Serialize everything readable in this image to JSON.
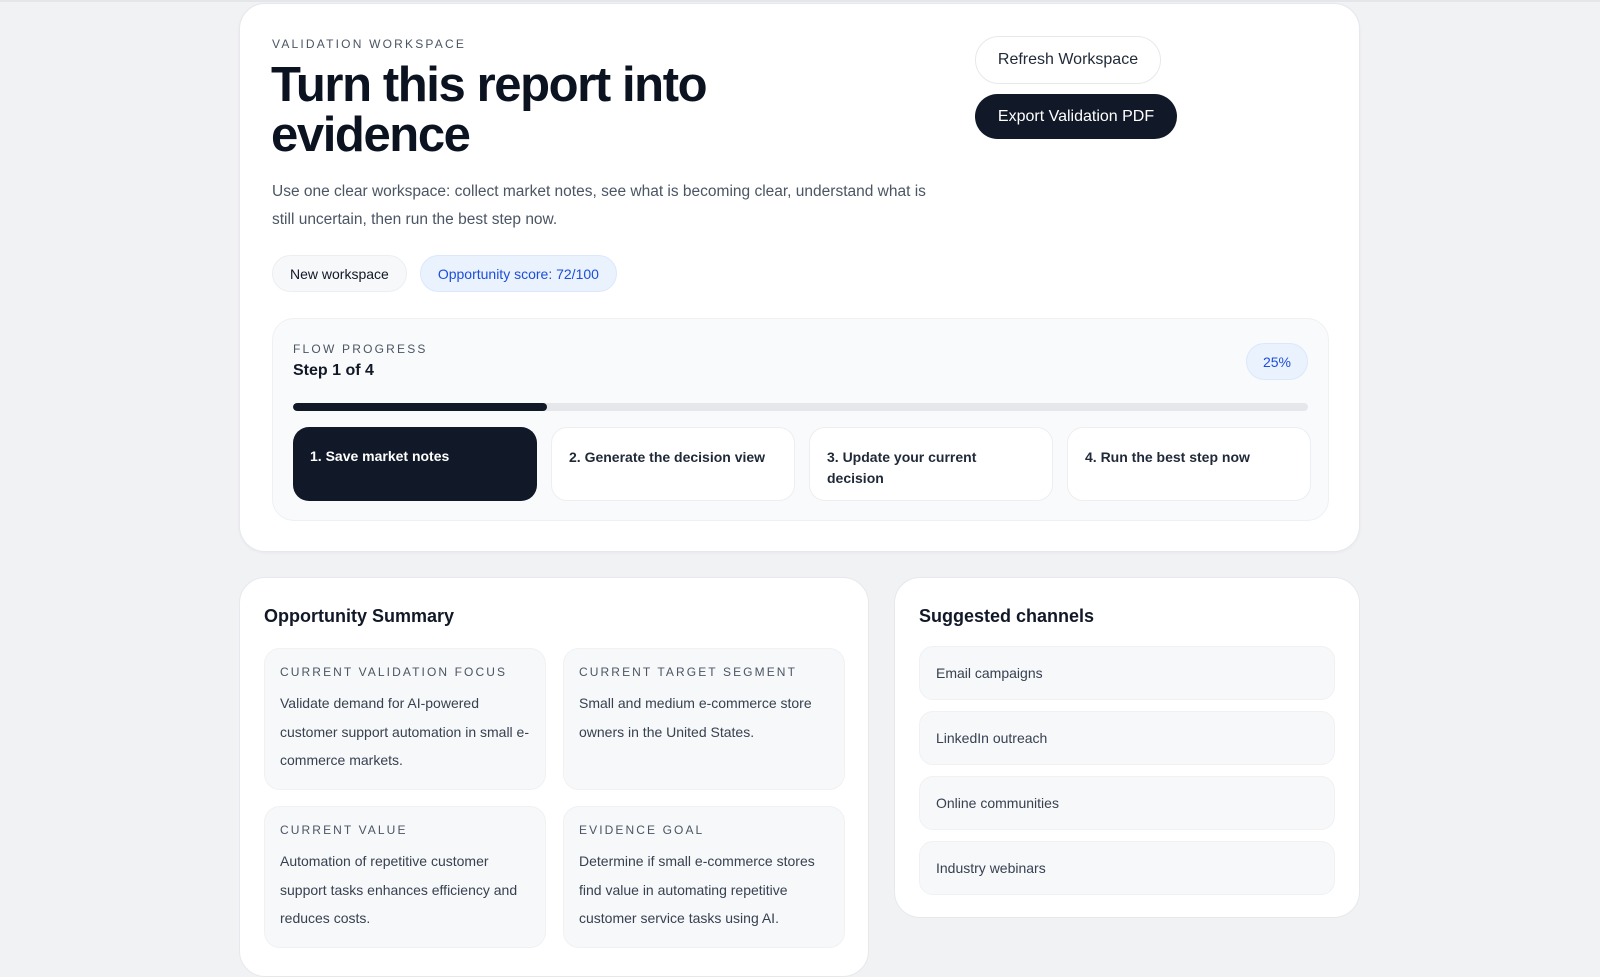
{
  "header": {
    "eyebrow": "VALIDATION WORKSPACE",
    "title": "Turn this report into evidence",
    "description": "Use one clear workspace: collect market notes, see what is becoming clear, understand what is still uncertain, then run the best step now.",
    "chips": {
      "workspace": "New workspace",
      "score": "Opportunity score: 72/100"
    },
    "buttons": {
      "refresh": "Refresh Workspace",
      "export": "Export Validation PDF"
    }
  },
  "flow": {
    "eyebrow": "FLOW PROGRESS",
    "step_text": "Step 1 of 4",
    "percent_label": "25%",
    "progress": 0.25,
    "steps": [
      {
        "label": "1. Save market notes",
        "active": true
      },
      {
        "label": "2. Generate the decision view",
        "active": false
      },
      {
        "label": "3. Update your current decision",
        "active": false
      },
      {
        "label": "4. Run the best step now",
        "active": false
      }
    ]
  },
  "summary": {
    "title": "Opportunity Summary",
    "tiles": [
      {
        "label": "CURRENT VALIDATION FOCUS",
        "text": "Validate demand for AI-powered customer support automation in small e-commerce markets."
      },
      {
        "label": "CURRENT TARGET SEGMENT",
        "text": "Small and medium e-commerce store owners in the United States."
      },
      {
        "label": "CURRENT VALUE",
        "text": "Automation of repetitive customer support tasks enhances efficiency and reduces costs."
      },
      {
        "label": "EVIDENCE GOAL",
        "text": "Determine if small e-commerce stores find value in automating repetitive customer service tasks using AI."
      }
    ]
  },
  "channels": {
    "title": "Suggested channels",
    "items": [
      "Email campaigns",
      "LinkedIn outreach",
      "Online communities",
      "Industry webinars"
    ]
  },
  "colors": {
    "accent_dark": "#111827",
    "accent_blue": "#1d4ed8",
    "badge_bg": "#eaf2fe",
    "page_bg": "#f1f2f4"
  }
}
